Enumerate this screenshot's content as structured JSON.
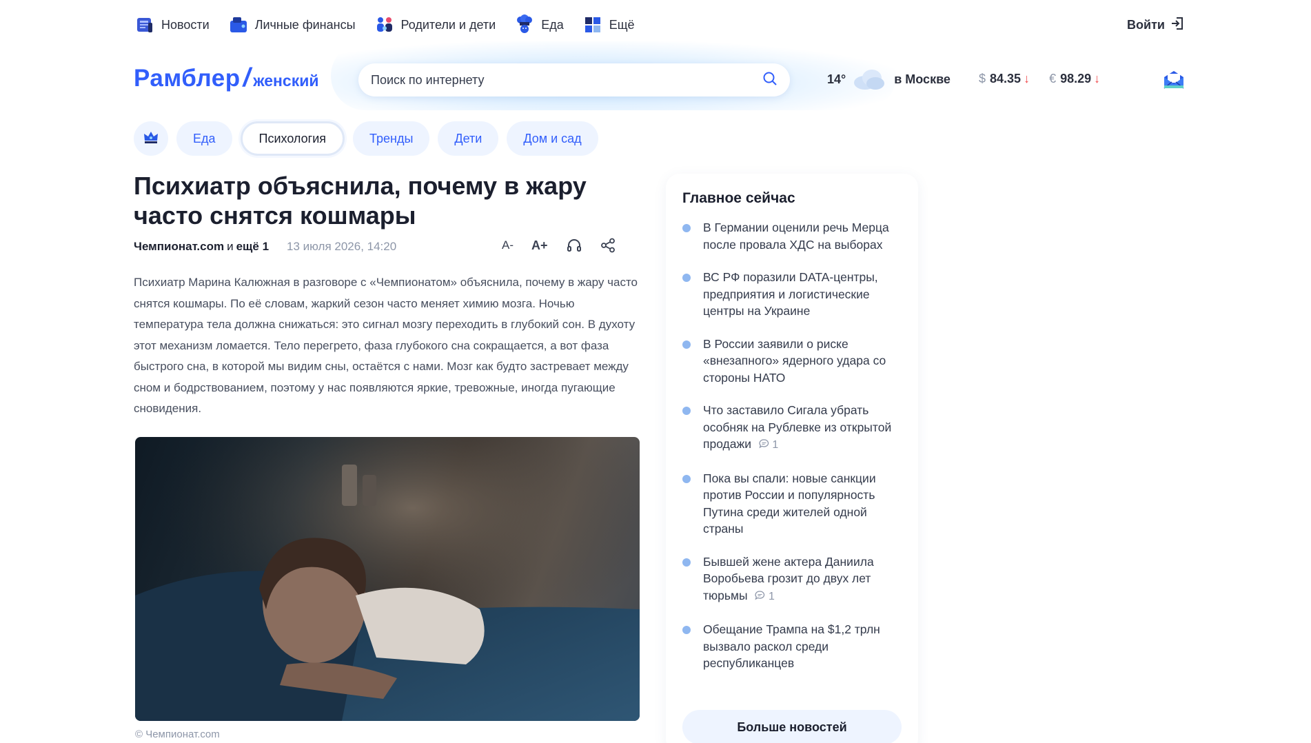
{
  "topnav": {
    "items": [
      {
        "label": "Новости",
        "icon": "news-icon"
      },
      {
        "label": "Личные финансы",
        "icon": "finance-icon"
      },
      {
        "label": "Родители и дети",
        "icon": "family-icon"
      },
      {
        "label": "Еда",
        "icon": "chef-icon"
      },
      {
        "label": "Ещё",
        "icon": "grid-icon"
      }
    ],
    "login_label": "Войти"
  },
  "header": {
    "logo_main": "Рамблер",
    "logo_slash": "/",
    "logo_sub": "женский",
    "search_placeholder": "Поиск по интернету",
    "weather_temp": "14°",
    "weather_city": "в Москве",
    "usd_symbol": "$",
    "usd_value": "84.35",
    "eur_symbol": "€",
    "eur_value": "98.29",
    "down_arrow": "↓"
  },
  "tabs": {
    "items": [
      "Еда",
      "Психология",
      "Тренды",
      "Дети",
      "Дом и сад"
    ],
    "active": "Психология"
  },
  "article": {
    "title": "Психиатр объяснила, почему в жару часто снятся кошмары",
    "source": "Чемпионат.com",
    "and_text": "и",
    "more_sources": "ещё 1",
    "date": "13 июля 2026, 14:20",
    "font_smaller": "A-",
    "font_larger": "A+",
    "body": "Психиатр Марина Калюжная в разговоре с «Чемпионатом» объяснила, почему в жару часто снятся кошмары. По её словам, жаркий сезон часто меняет химию мозга. Ночью температура тела должна снижаться: это сигнал мозгу переходить в глубокий сон. В духоту этот механизм ломается. Тело перегрето, фаза глубокого сна сокращается, а вот фаза быстрого сна, в которой мы видим сны, остаётся с нами. Мозг как будто застревает между сном и бодрствованием, поэтому у нас появляются яркие, тревожные, иногда пугающие сновидения.",
    "caption": "© Чемпионат.com"
  },
  "sidebar": {
    "title": "Главное сейчас",
    "news": [
      {
        "text": "В Германии оценили речь Мерца после провала ХДС на выборах",
        "comments": ""
      },
      {
        "text": "ВС РФ поразили DATA-центры, предприятия и логистические центры на Украине",
        "comments": ""
      },
      {
        "text": "В России заявили о риске «внезапного» ядерного удара со стороны НАТО",
        "comments": ""
      },
      {
        "text": "Что заставило Сигала убрать особняк на Рублевке из открытой продажи",
        "comments": "1"
      },
      {
        "text": "Пока вы спали: новые санкции против России и популярность Путина среди жителей одной страны",
        "comments": ""
      },
      {
        "text": "Бывшей жене актера Даниила Воробьева грозит до двух лет тюрьмы",
        "comments": "1"
      },
      {
        "text": "Обещание Трампа на $1,2 трлн вызвало раскол среди республиканцев",
        "comments": ""
      }
    ],
    "more_button": "Больше новостей"
  },
  "colors": {
    "brand": "#315efb",
    "down": "#f0484b",
    "tab_bg": "#eef4ff"
  }
}
